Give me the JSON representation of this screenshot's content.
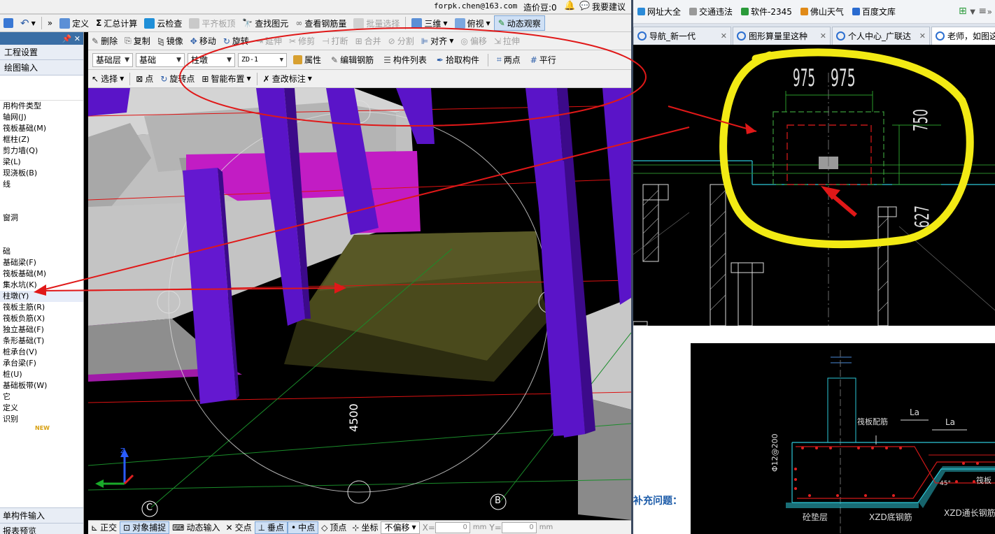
{
  "titlebar": {
    "email": "forpk.chen@163.com",
    "price_label": "造价豆:0",
    "ask_label": "我要建议"
  },
  "toolbar1": {
    "define": "定义",
    "sum": "汇总计算",
    "cloud_check": "云检查",
    "flush_top": "平齐板顶",
    "find_element": "查找图元",
    "view_rebar": "查看钢筋量",
    "batch_select": "批量选择",
    "three_d": "三维",
    "top_view": "俯视",
    "dynamic_view": "动态观察"
  },
  "toolbar2": {
    "delete": "删除",
    "copy": "复制",
    "mirror": "镜像",
    "move": "移动",
    "rotate": "旋转",
    "extend": "延伸",
    "trim": "修剪",
    "break": "打断",
    "merge": "合并",
    "split": "分割",
    "align": "对齐",
    "offset": "偏移",
    "stretch": "拉伸"
  },
  "toolbar3": {
    "layer": "基础层",
    "category": "基础",
    "type": "柱墩",
    "name": "ZD-1",
    "props": "属性",
    "edit_rebar": "编辑钢筋",
    "element_list": "构件列表",
    "pick": "拾取构件",
    "two_points": "两点",
    "parallel": "平行"
  },
  "toolbar4": {
    "select": "选择",
    "point": "点",
    "rotate_point": "旋转点",
    "smart_layout": "智能布置",
    "edit_label": "查改标注"
  },
  "sidebar": {
    "header": "",
    "project_settings": "工程设置",
    "drawing_input": "绘图输入",
    "items": [
      "用构件类型",
      "轴网(J)",
      "筏板基础(M)",
      "框柱(Z)",
      "剪力墙(Q)",
      "梁(L)",
      "现浇板(B)",
      "线",
      "",
      "",
      "窗洞",
      "",
      "",
      "础",
      "基础梁(F)",
      "筏板基础(M)",
      "集水坑(K)",
      "柱墩(Y)",
      "筏板主筋(R)",
      "筏板负筋(X)",
      "独立基础(F)",
      "条形基础(T)",
      "桩承台(V)",
      "承台梁(F)",
      "桩(U)",
      "基础板带(W)",
      "它",
      "定义",
      "识别"
    ],
    "new_badge": "NEW",
    "single_input": "单构件输入",
    "report_preview": "报表预览"
  },
  "viewport": {
    "dim_label": "4500",
    "axis_c": "C",
    "axis_b": "B"
  },
  "statusbar": {
    "ortho": "正交",
    "snap": "对象捕捉",
    "dynamic_input": "动态输入",
    "intersect": "交点",
    "perpendicular": "垂点",
    "midpoint": "中点",
    "vertex": "顶点",
    "coord": "坐标",
    "offset_mode": "不偏移",
    "x_label": "X=",
    "x_value": "0",
    "y_label": "Y=",
    "y_value": "0",
    "unit": "mm"
  },
  "browser": {
    "bookmarks": [
      "网址大全",
      "交通违法",
      "软件-2345",
      "佛山天气",
      "百度文库"
    ],
    "tabs": [
      "导航_新一代",
      "图形算量里这种",
      "个人中心_广联达",
      "老师，如图这样的"
    ]
  },
  "cad": {
    "dim_975_a": "975",
    "dim_975_b": "975",
    "dim_750": "750",
    "dim_627": "627"
  },
  "question": {
    "label": "补充问题："
  },
  "detail": {
    "raft_rebar": "筏板配筋",
    "la1": "La",
    "la2": "La",
    "rebar_spec": "Φ12@200",
    "raft_label": "筏板",
    "xzd_through": "XZD通长钢筋",
    "cushion": "砼垫层",
    "xzd_bottom": "XZD底钢筋",
    "angle": "45°"
  }
}
